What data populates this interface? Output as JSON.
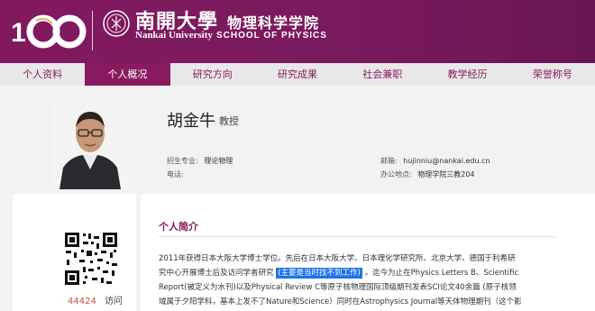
{
  "header": {
    "logo_text": "100",
    "university_cn": "南開大學",
    "university_en": "Nankai University",
    "school_cn": "物理科学学院",
    "school_en": "SCHOOL OF PHYSICS",
    "brand_color": "#7a1a5e"
  },
  "nav": {
    "items": [
      {
        "label": "个人资料",
        "active": false
      },
      {
        "label": "个人概况",
        "active": true
      },
      {
        "label": "研究方向",
        "active": false
      },
      {
        "label": "研究成果",
        "active": false
      },
      {
        "label": "社会兼职",
        "active": false
      },
      {
        "label": "教学经历",
        "active": false
      },
      {
        "label": "荣誉称号",
        "active": false
      }
    ]
  },
  "profile": {
    "name": "胡金牛",
    "title": "教授",
    "major_label": "招生专业:",
    "major_value": "理论物理",
    "phone_label": "电话:",
    "phone_value": "",
    "email_label": "邮箱:",
    "email_value": "hujinniu@nankai.edu.cn",
    "office_label": "办公地点:",
    "office_value": "物理学院三教204"
  },
  "sidebar": {
    "visits": "44424",
    "visits_label": "访问"
  },
  "intro": {
    "heading": "个人简介",
    "line1": "2011年获得日本大阪大学博士学位。先后在日本大阪大学、日本理化学研究所、北京大学、德国于利希研",
    "line2_pre": "究中心开展博士后及访问学者研究",
    "line2_hl": "(主要是当时找不到工作)",
    "line2_post": "。迄今为止在Physics Letters B、Scientific",
    "line3": "Report(被定义为水刊)以及Physical Review C等原子核物理国际顶级期刊发表SCI论文40余篇 (原子核领",
    "line4": "域属于夕阳学科，基本上发不了Nature和Science）同时在Astrophysics Journal等天体物理期刊（这个影"
  }
}
